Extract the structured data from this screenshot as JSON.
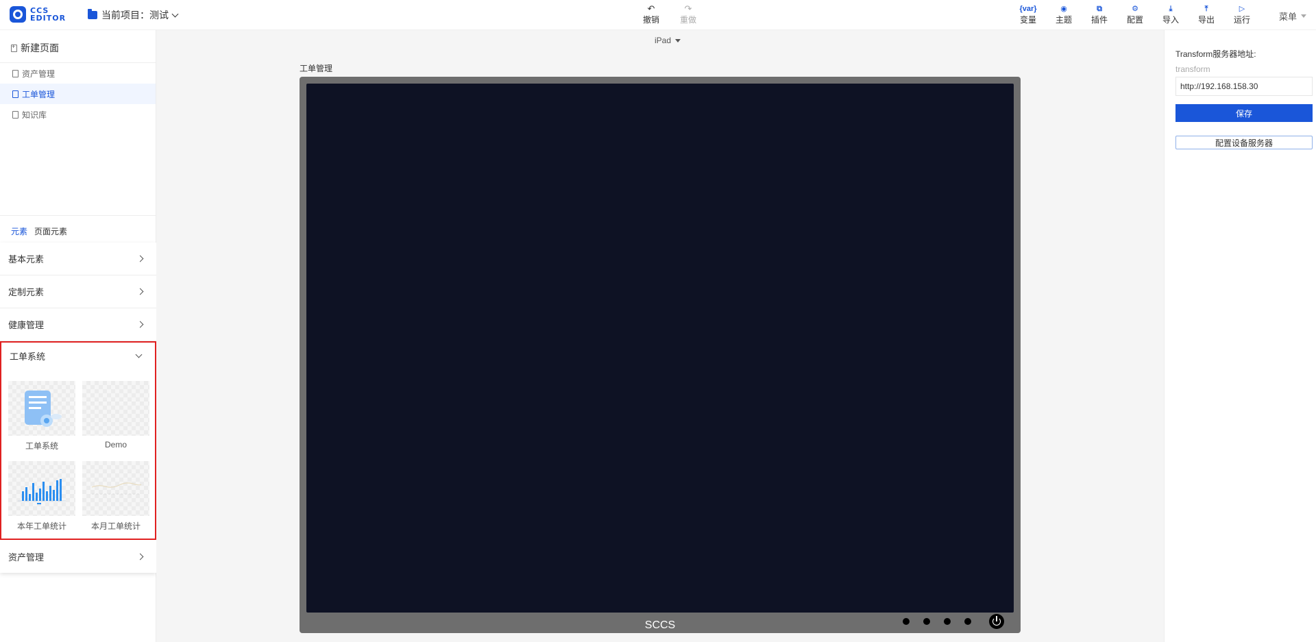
{
  "header": {
    "logo_text_1": "CCS",
    "logo_text_2": "EDITOR",
    "project_label": "当前项目：测试",
    "center_tools": [
      {
        "label": "撤销",
        "icon": "undo-icon",
        "glyph": "↶",
        "disabled": false
      },
      {
        "label": "重做",
        "icon": "redo-icon",
        "glyph": "↷",
        "disabled": true
      }
    ],
    "right_tools": [
      {
        "label": "变量",
        "icon": "variable-icon",
        "glyph": "{var}"
      },
      {
        "label": "主题",
        "icon": "theme-icon",
        "glyph": "◉"
      },
      {
        "label": "插件",
        "icon": "plugin-icon",
        "glyph": "⧉"
      },
      {
        "label": "配置",
        "icon": "settings-icon",
        "glyph": "⚙"
      },
      {
        "label": "导入",
        "icon": "import-icon",
        "glyph": "⤓"
      },
      {
        "label": "导出",
        "icon": "export-icon",
        "glyph": "⤒"
      },
      {
        "label": "运行",
        "icon": "run-icon",
        "glyph": "▷"
      }
    ],
    "menu_label": "菜单"
  },
  "sidebar": {
    "new_page": "新建页面",
    "pages": [
      {
        "label": "资产管理",
        "active": false
      },
      {
        "label": "工单管理",
        "active": true
      },
      {
        "label": "知识库",
        "active": false
      }
    ],
    "tabs": [
      {
        "label": "元素",
        "active": true
      },
      {
        "label": "页面元素",
        "active": false
      }
    ],
    "sections": [
      {
        "label": "基本元素"
      },
      {
        "label": "定制元素"
      },
      {
        "label": "健康管理"
      }
    ],
    "expanded_section": {
      "label": "工单系统",
      "components": [
        {
          "label": "工单系统",
          "thumb": "workorder-icon"
        },
        {
          "label": "Demo",
          "thumb": "blank"
        },
        {
          "label": "本年工单统计",
          "thumb": "bar-chart"
        },
        {
          "label": "本月工单统计",
          "thumb": "line-chart"
        }
      ]
    },
    "last_section": {
      "label": "资产管理"
    }
  },
  "canvas": {
    "device": "iPad",
    "page_name": "工单管理",
    "brand": "SCCS"
  },
  "right_panel": {
    "label": "Transform服务器地址:",
    "sub_label": "transform",
    "input_value": "http://192.168.158.30",
    "save_label": "保存",
    "config_label": "配置设备服务器"
  },
  "colors": {
    "accent": "#1a56d9",
    "screen": "#0e1224",
    "frame": "#6e6e6e",
    "highlight": "#e02020"
  }
}
